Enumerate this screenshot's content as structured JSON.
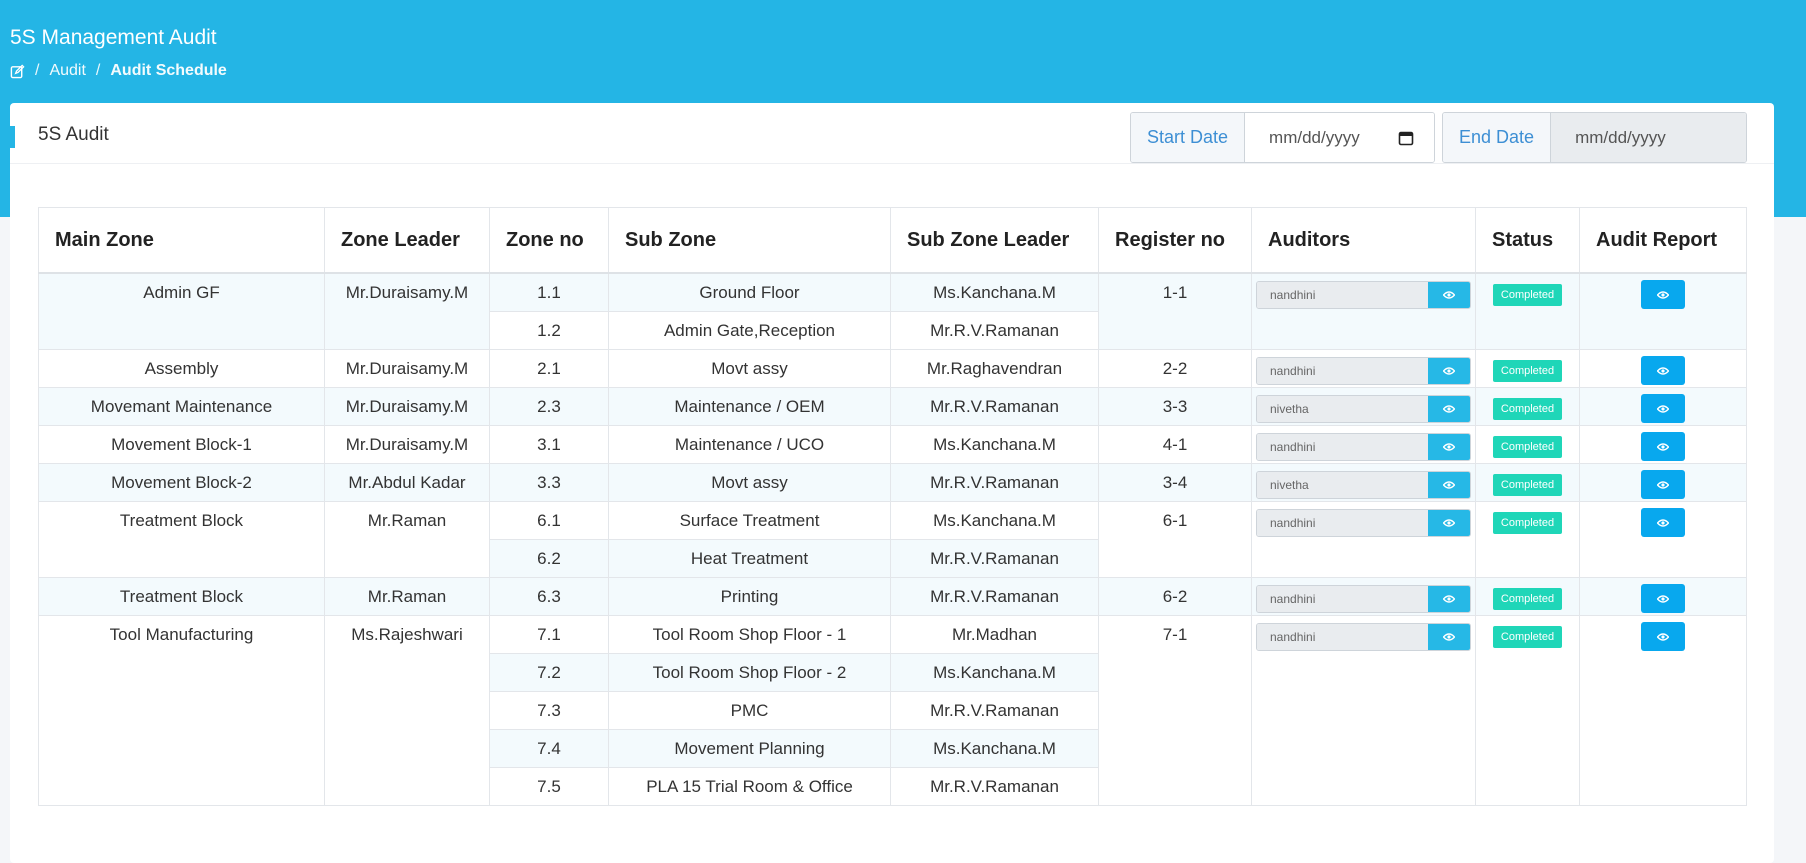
{
  "header": {
    "title": "5S Management Audit",
    "breadcrumb": [
      "Audit",
      "Audit Schedule"
    ]
  },
  "card": {
    "title": "5S Audit",
    "start_label": "Start Date",
    "start_placeholder": "mm/dd/yyyy",
    "end_label": "End Date",
    "end_placeholder": "mm/dd/yyyy"
  },
  "table": {
    "headers": [
      "Main Zone",
      "Zone Leader",
      "Zone no",
      "Sub Zone",
      "Sub Zone Leader",
      "Register no",
      "Auditors",
      "Status",
      "Audit Report"
    ],
    "rows": [
      {
        "main_zone": "Admin GF",
        "zone_leader": "Mr.Duraisamy.M",
        "register": "1-1",
        "auditor": "nandhini",
        "status": "Completed",
        "subs": [
          {
            "no": "1.1",
            "name": "Ground Floor",
            "leader": "Ms.Kanchana.M"
          },
          {
            "no": "1.2",
            "name": "Admin Gate,Reception",
            "leader": "Mr.R.V.Ramanan"
          }
        ]
      },
      {
        "main_zone": "Assembly",
        "zone_leader": "Mr.Duraisamy.M",
        "register": "2-2",
        "auditor": "nandhini",
        "status": "Completed",
        "subs": [
          {
            "no": "2.1",
            "name": "Movt assy",
            "leader": "Mr.Raghavendran"
          }
        ]
      },
      {
        "main_zone": "Movemant Maintenance",
        "zone_leader": "Mr.Duraisamy.M",
        "register": "3-3",
        "auditor": "nivetha",
        "status": "Completed",
        "subs": [
          {
            "no": "2.3",
            "name": "Maintenance / OEM",
            "leader": "Mr.R.V.Ramanan"
          }
        ]
      },
      {
        "main_zone": "Movement Block-1",
        "zone_leader": "Mr.Duraisamy.M",
        "register": "4-1",
        "auditor": "nandhini",
        "status": "Completed",
        "subs": [
          {
            "no": "3.1",
            "name": "Maintenance / UCO",
            "leader": "Ms.Kanchana.M"
          }
        ]
      },
      {
        "main_zone": "Movement Block-2",
        "zone_leader": "Mr.Abdul Kadar",
        "register": "3-4",
        "auditor": "nivetha",
        "status": "Completed",
        "subs": [
          {
            "no": "3.3",
            "name": "Movt assy",
            "leader": "Mr.R.V.Ramanan"
          }
        ]
      },
      {
        "main_zone": "Treatment Block",
        "zone_leader": "Mr.Raman",
        "register": "6-1",
        "auditor": "nandhini",
        "status": "Completed",
        "subs": [
          {
            "no": "6.1",
            "name": "Surface Treatment",
            "leader": "Ms.Kanchana.M"
          },
          {
            "no": "6.2",
            "name": "Heat Treatment",
            "leader": "Mr.R.V.Ramanan"
          }
        ]
      },
      {
        "main_zone": "Treatment Block",
        "zone_leader": "Mr.Raman",
        "register": "6-2",
        "auditor": "nandhini",
        "status": "Completed",
        "subs": [
          {
            "no": "6.3",
            "name": "Printing",
            "leader": "Mr.R.V.Ramanan"
          }
        ]
      },
      {
        "main_zone": "Tool Manufacturing",
        "zone_leader": "Ms.Rajeshwari",
        "register": "7-1",
        "auditor": "nandhini",
        "status": "Completed",
        "subs": [
          {
            "no": "7.1",
            "name": "Tool Room Shop Floor - 1",
            "leader": "Mr.Madhan"
          },
          {
            "no": "7.2",
            "name": "Tool Room Shop Floor - 2",
            "leader": "Ms.Kanchana.M"
          },
          {
            "no": "7.3",
            "name": "PMC",
            "leader": "Mr.R.V.Ramanan"
          },
          {
            "no": "7.4",
            "name": "Movement Planning",
            "leader": "Ms.Kanchana.M"
          },
          {
            "no": "7.5",
            "name": "PLA 15 Trial Room & Office",
            "leader": "Mr.R.V.Ramanan"
          }
        ]
      }
    ]
  },
  "icons": {
    "breadcrumb_home": "edit-icon",
    "calendar": "calendar-icon",
    "view": "eye-icon"
  },
  "colors": {
    "header_bg": "#24b5e5",
    "status_badge": "#1fd6b8",
    "report_button": "#08a8ee"
  }
}
